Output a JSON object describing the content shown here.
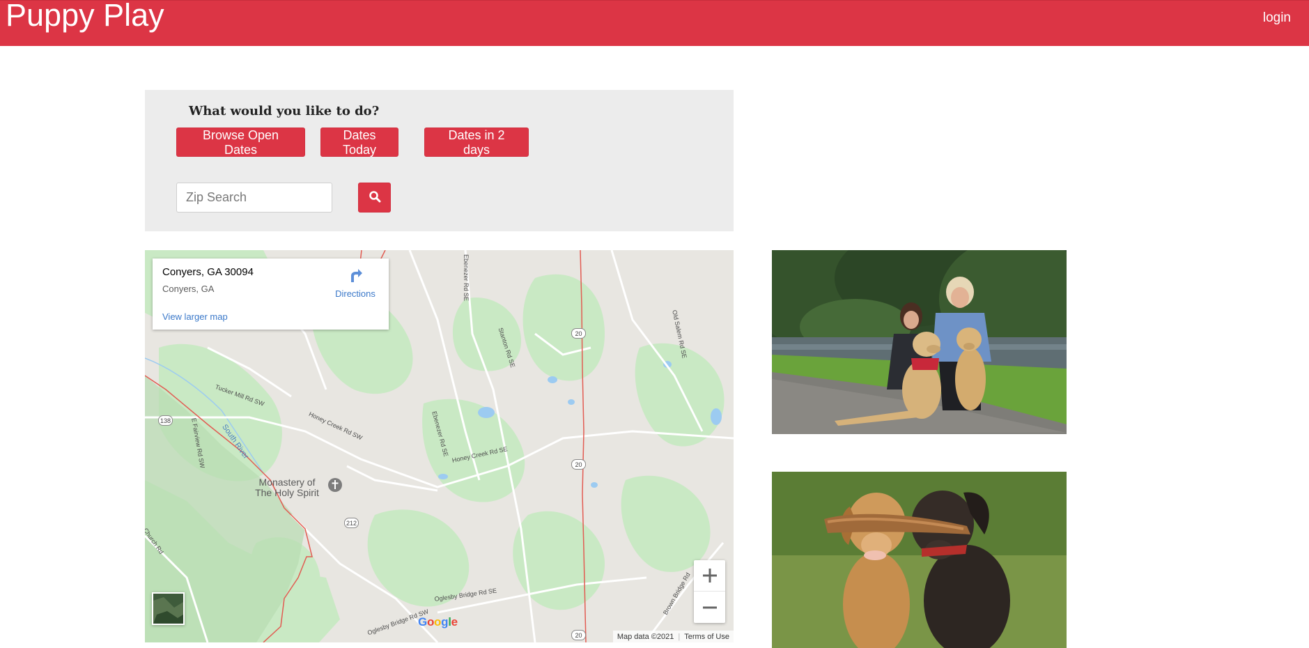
{
  "navbar": {
    "brand": "Puppy Play",
    "login": "login",
    "color": "#dc3545"
  },
  "search_panel": {
    "title": "What would you like to do?",
    "buttons": [
      {
        "label": "Browse Open Dates"
      },
      {
        "label": "Dates Today"
      },
      {
        "label": "Dates in 2 days"
      }
    ],
    "zip_placeholder": "Zip Search",
    "zip_value": "",
    "search_icon": "search-icon"
  },
  "map": {
    "place_name": "Conyers, GA 30094",
    "place_address": "Conyers, GA",
    "directions_label": "Directions",
    "view_larger_label": "View larger map",
    "zoom_in": "+",
    "zoom_out": "−",
    "google_logo": "Google",
    "attribution": "Map data ©2021",
    "terms": "Terms of Use",
    "poi": "Monastery of The Holy Spirit",
    "road_labels": [
      "Tucker Mill Rd SW",
      "Honey Creek Rd SW",
      "Honey Creek Rd SE",
      "Ebenezer Rd SE",
      "Ebenezer Rd SE",
      "Stanton Rd SE",
      "Old Salem Rd SE",
      "South River",
      "E Fairview Rd SW",
      "Oglesby Bridge Rd SE",
      "Oglesby Bridge Rd SW",
      "Brown Bridge Rd",
      "Church Rd"
    ],
    "shields": [
      "138",
      "20",
      "20",
      "20",
      "212"
    ]
  },
  "photos": [
    {
      "name": "photo-dogs-with-owners"
    },
    {
      "name": "photo-dogs-with-stick"
    }
  ]
}
